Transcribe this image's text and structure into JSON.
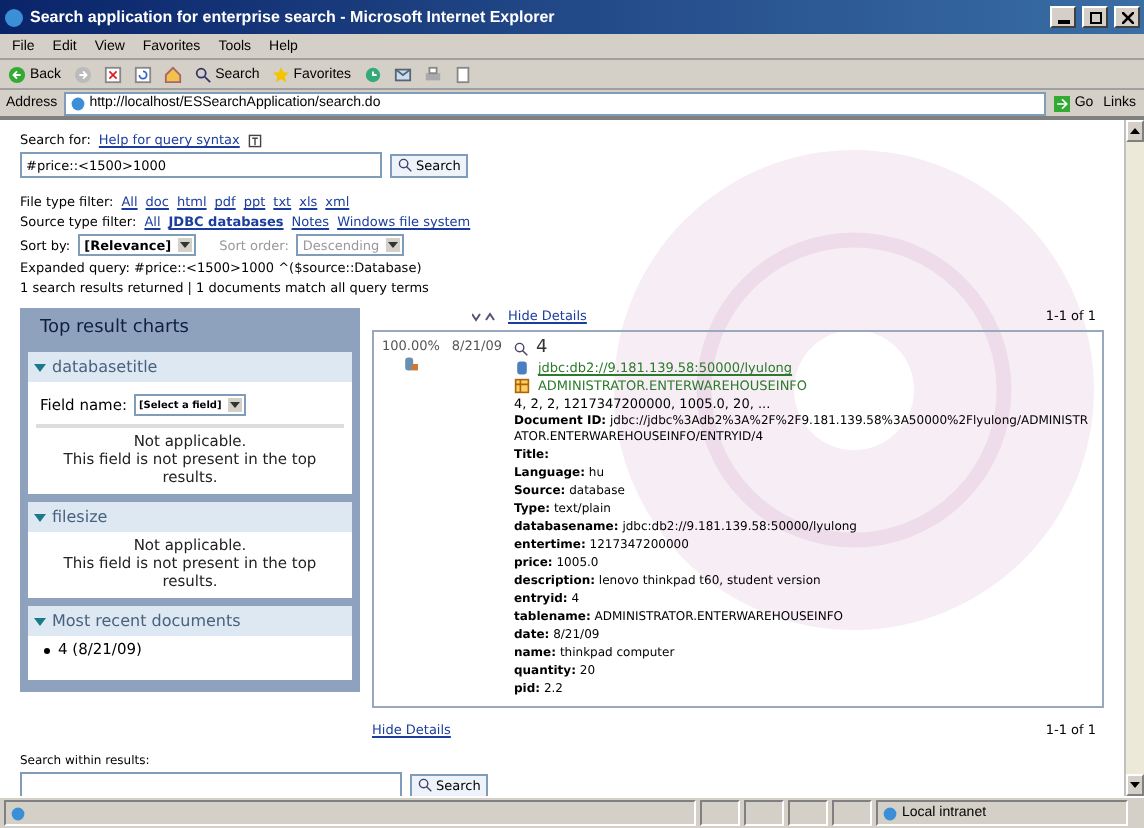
{
  "window": {
    "title": "Search application for enterprise search - Microsoft Internet Explorer"
  },
  "menu": [
    "File",
    "Edit",
    "View",
    "Favorites",
    "Tools",
    "Help"
  ],
  "toolbar": [
    {
      "kind": "back",
      "label": "Back"
    },
    {
      "kind": "forward"
    },
    {
      "kind": "stop"
    },
    {
      "kind": "refresh"
    },
    {
      "kind": "home"
    },
    {
      "kind": "search",
      "label": "Search"
    },
    {
      "kind": "favorites",
      "label": "Favorites"
    },
    {
      "kind": "history"
    },
    {
      "kind": "mail"
    },
    {
      "kind": "print"
    },
    {
      "kind": "edit"
    }
  ],
  "address": {
    "label": "Address",
    "url": "http://localhost/ESSearchApplication/search.do",
    "go": "Go",
    "links": "Links"
  },
  "search": {
    "label": "Search for:",
    "help": "Help for query syntax",
    "value": "#price::<1500>1000",
    "button": "Search"
  },
  "file_filter": {
    "label": "File type filter:",
    "options": [
      {
        "label": "All",
        "selected": false
      },
      {
        "label": "doc",
        "selected": false
      },
      {
        "label": "html",
        "selected": false
      },
      {
        "label": "pdf",
        "selected": false
      },
      {
        "label": "ppt",
        "selected": false
      },
      {
        "label": "txt",
        "selected": false
      },
      {
        "label": "xls",
        "selected": false
      },
      {
        "label": "xml",
        "selected": false
      }
    ]
  },
  "source_filter": {
    "label": "Source type filter:",
    "options": [
      {
        "label": "All",
        "selected": false
      },
      {
        "label": "JDBC databases",
        "selected": true
      },
      {
        "label": "Notes",
        "selected": false
      },
      {
        "label": "Windows file system",
        "selected": false
      }
    ]
  },
  "sort": {
    "label": "Sort by:",
    "value": "[Relevance]",
    "order_label": "Sort order:",
    "order_value": "Descending",
    "order_disabled": true
  },
  "expanded_query": "Expanded query: #price::<1500>1000 ^($source::Database)",
  "summary": "1 search results returned | 1 documents match all query terms",
  "charts": {
    "title": "Top result charts",
    "sections": [
      {
        "kind": "field",
        "title": "databasetitle",
        "expanded": true,
        "field_label": "Field name:",
        "field_value": "[Select a field]",
        "message": "Not applicable.\nThis field is not present in the top results."
      },
      {
        "kind": "message",
        "title": "filesize",
        "expanded": true,
        "message": "Not applicable.\nThis field is not present in the top results."
      },
      {
        "kind": "list",
        "title": "Most recent documents",
        "expanded": true,
        "items": [
          "4 (8/21/09)"
        ]
      }
    ]
  },
  "results": {
    "toggle": "Hide Details",
    "range": "1-1 of 1",
    "items": [
      {
        "score": "100.00%",
        "date": "8/21/09",
        "title": "4",
        "source": "jdbc:db2://9.181.139.58:50000/lyulong",
        "table": "ADMINISTRATOR.ENTERWAREHOUSEINFO",
        "snippet": "4, 2, 2, 1217347200000, 1005.0, 20, ...",
        "fields": [
          {
            "name": "Document ID:",
            "value": "jdbc://jdbc%3Adb2%3A%2F%2F9.181.139.58%3A50000%2Flyulong/ADMINISTRATOR.ENTERWAREHOUSEINFO/ENTRYID/4"
          },
          {
            "name": "Title:"
          },
          {
            "name": "Language:",
            "value": "hu"
          },
          {
            "name": "Source:",
            "value": "database"
          },
          {
            "name": "Type:",
            "value": "text/plain"
          },
          {
            "name": "databasename:",
            "value": "jdbc:db2://9.181.139.58:50000/lyulong"
          },
          {
            "name": "entertime:",
            "value": "1217347200000"
          },
          {
            "name": "price:",
            "value": "1005.0"
          },
          {
            "name": "description:",
            "value": "lenovo thinkpad t60, student version"
          },
          {
            "name": "entryid:",
            "value": "4"
          },
          {
            "name": "tablename:",
            "value": "ADMINISTRATOR.ENTERWAREHOUSEINFO"
          },
          {
            "name": "date:",
            "value": "8/21/09"
          },
          {
            "name": "name:",
            "value": "thinkpad computer"
          },
          {
            "name": "quantity:",
            "value": "20"
          },
          {
            "name": "pid:",
            "value": "2.2"
          }
        ]
      }
    ],
    "footer_toggle": "Hide Details",
    "footer_range": "1-1 of 1"
  },
  "within": {
    "label": "Search within results:",
    "button": "Search"
  },
  "status": {
    "zone": "Local intranet"
  }
}
